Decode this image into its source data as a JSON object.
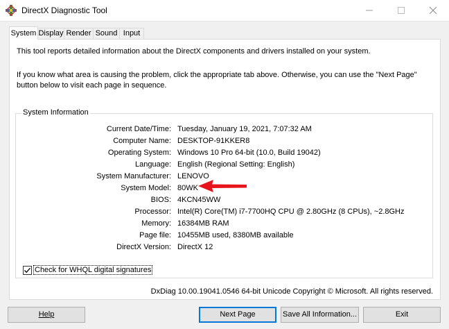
{
  "window": {
    "title": "DirectX Diagnostic Tool",
    "minimize_icon": "minimize-icon",
    "maximize_icon": "maximize-icon",
    "close_icon": "close-icon"
  },
  "tabs": [
    {
      "label": "System",
      "active": true
    },
    {
      "label": "Display"
    },
    {
      "label": "Render"
    },
    {
      "label": "Sound"
    },
    {
      "label": "Input"
    }
  ],
  "intro": {
    "line1": "This tool reports detailed information about the DirectX components and drivers installed on your system.",
    "line2": "If you know what area is causing the problem, click the appropriate tab above.  Otherwise, you can use the \"Next Page\" button below to visit each page in sequence."
  },
  "system_info": {
    "title": "System Information",
    "rows": [
      {
        "label": "Current Date/Time:",
        "value": "Tuesday, January 19, 2021, 7:07:32 AM"
      },
      {
        "label": "Computer Name:",
        "value": "DESKTOP-91KKER8"
      },
      {
        "label": "Operating System:",
        "value": "Windows 10 Pro 64-bit (10.0, Build 19042)"
      },
      {
        "label": "Language:",
        "value": "English (Regional Setting: English)"
      },
      {
        "label": "System Manufacturer:",
        "value": "LENOVO"
      },
      {
        "label": "System Model:",
        "value": "80WK"
      },
      {
        "label": "BIOS:",
        "value": "4KCN45WW"
      },
      {
        "label": "Processor:",
        "value": "Intel(R) Core(TM) i7-7700HQ CPU @ 2.80GHz (8 CPUs), ~2.8GHz"
      },
      {
        "label": "Memory:",
        "value": "16384MB RAM"
      },
      {
        "label": "Page file:",
        "value": "10455MB used, 8380MB available"
      },
      {
        "label": "DirectX Version:",
        "value": "DirectX 12"
      }
    ]
  },
  "whql_checkbox": {
    "label": "Check for WHQL digital signatures",
    "checked": true
  },
  "footer": {
    "version_text": "DxDiag 10.00.19041.0546 64-bit Unicode  Copyright © Microsoft. All rights reserved."
  },
  "buttons": {
    "help": "Help",
    "next_page": "Next Page",
    "save_all": "Save All Information...",
    "exit": "Exit"
  },
  "colors": {
    "accent": "#0078d7",
    "annotation_arrow": "#e8141c"
  }
}
